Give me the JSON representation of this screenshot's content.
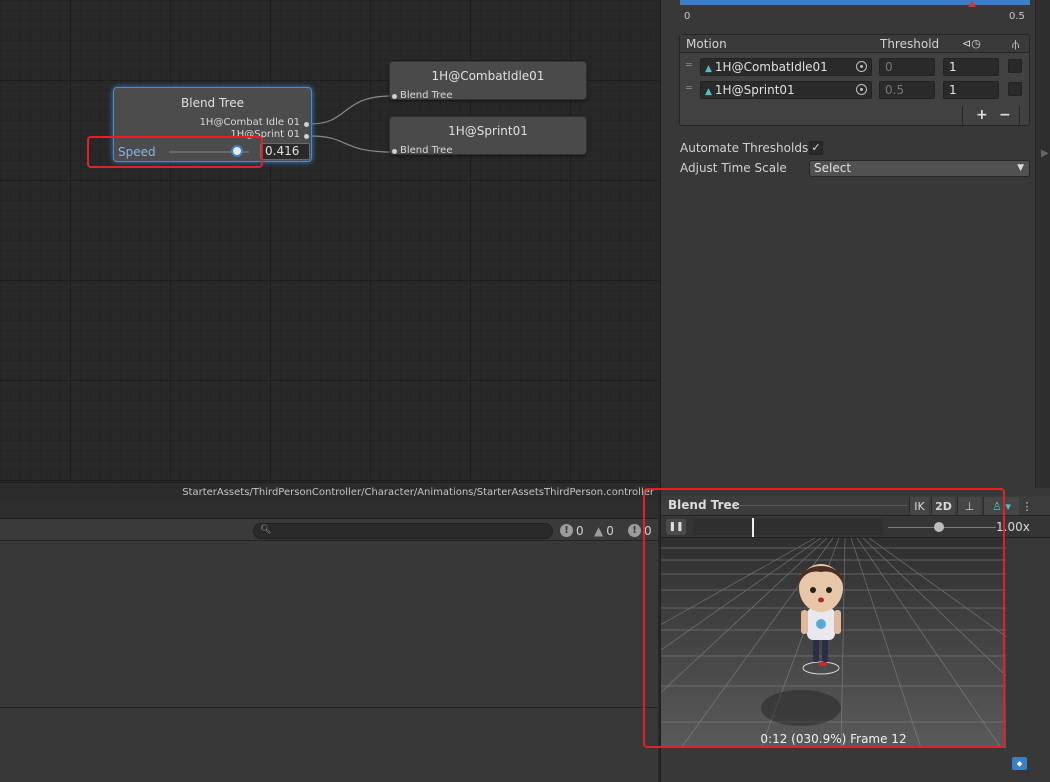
{
  "graph": {
    "blend_node": {
      "title": "Blend Tree",
      "ports": [
        "1H@Combat Idle 01",
        "1H@Sprint 01"
      ],
      "param_label": "Speed",
      "param_value": "0.416",
      "param_level": 0.832
    },
    "clips": [
      {
        "title": "1H@CombatIdle01",
        "port": "Blend Tree"
      },
      {
        "title": "1H@Sprint01",
        "port": "Blend Tree"
      }
    ]
  },
  "path": "StarterAssets/ThirdPersonController/Character/Animations/StarterAssetsThirdPerson.controller",
  "console": {
    "search_placeholder": "",
    "counts": {
      "info": "0",
      "warn": "0",
      "error": "0"
    }
  },
  "inspector": {
    "threshold_axis": {
      "min": "0",
      "max": "0.5",
      "marker": 0.416
    },
    "motion_table": {
      "headers": {
        "motion": "Motion",
        "threshold": "Threshold"
      },
      "rows": [
        {
          "motion": "1H@CombatIdle01",
          "threshold": "0",
          "time_scale": "1",
          "mirror": false
        },
        {
          "motion": "1H@Sprint01",
          "threshold": "0.5",
          "time_scale": "1",
          "mirror": false
        }
      ],
      "add_label": "+",
      "remove_label": "−"
    },
    "automate_thresholds": {
      "label": "Automate Thresholds",
      "checked": true,
      "check_glyph": "✓"
    },
    "adjust_time_scale": {
      "label": "Adjust Time Scale",
      "value": "Select"
    }
  },
  "preview": {
    "title": "Blend Tree",
    "ik_label": "IK",
    "mode_label": "2D",
    "speed_label": "1.00x",
    "status": "0:12 (030.9%) Frame 12",
    "playhead": 0.309
  },
  "colors": {
    "accent": "#3b7fc6",
    "highlight_red": "#e0202a",
    "panel": "#383838",
    "graph_bg": "#282828"
  },
  "icons": {
    "search": "search-icon",
    "info": "info-icon",
    "warn": "warning-icon",
    "error": "error-icon",
    "pause": "pause-icon",
    "avatar": "avatar-icon",
    "pivot": "pivot-icon",
    "label": "label-icon"
  }
}
